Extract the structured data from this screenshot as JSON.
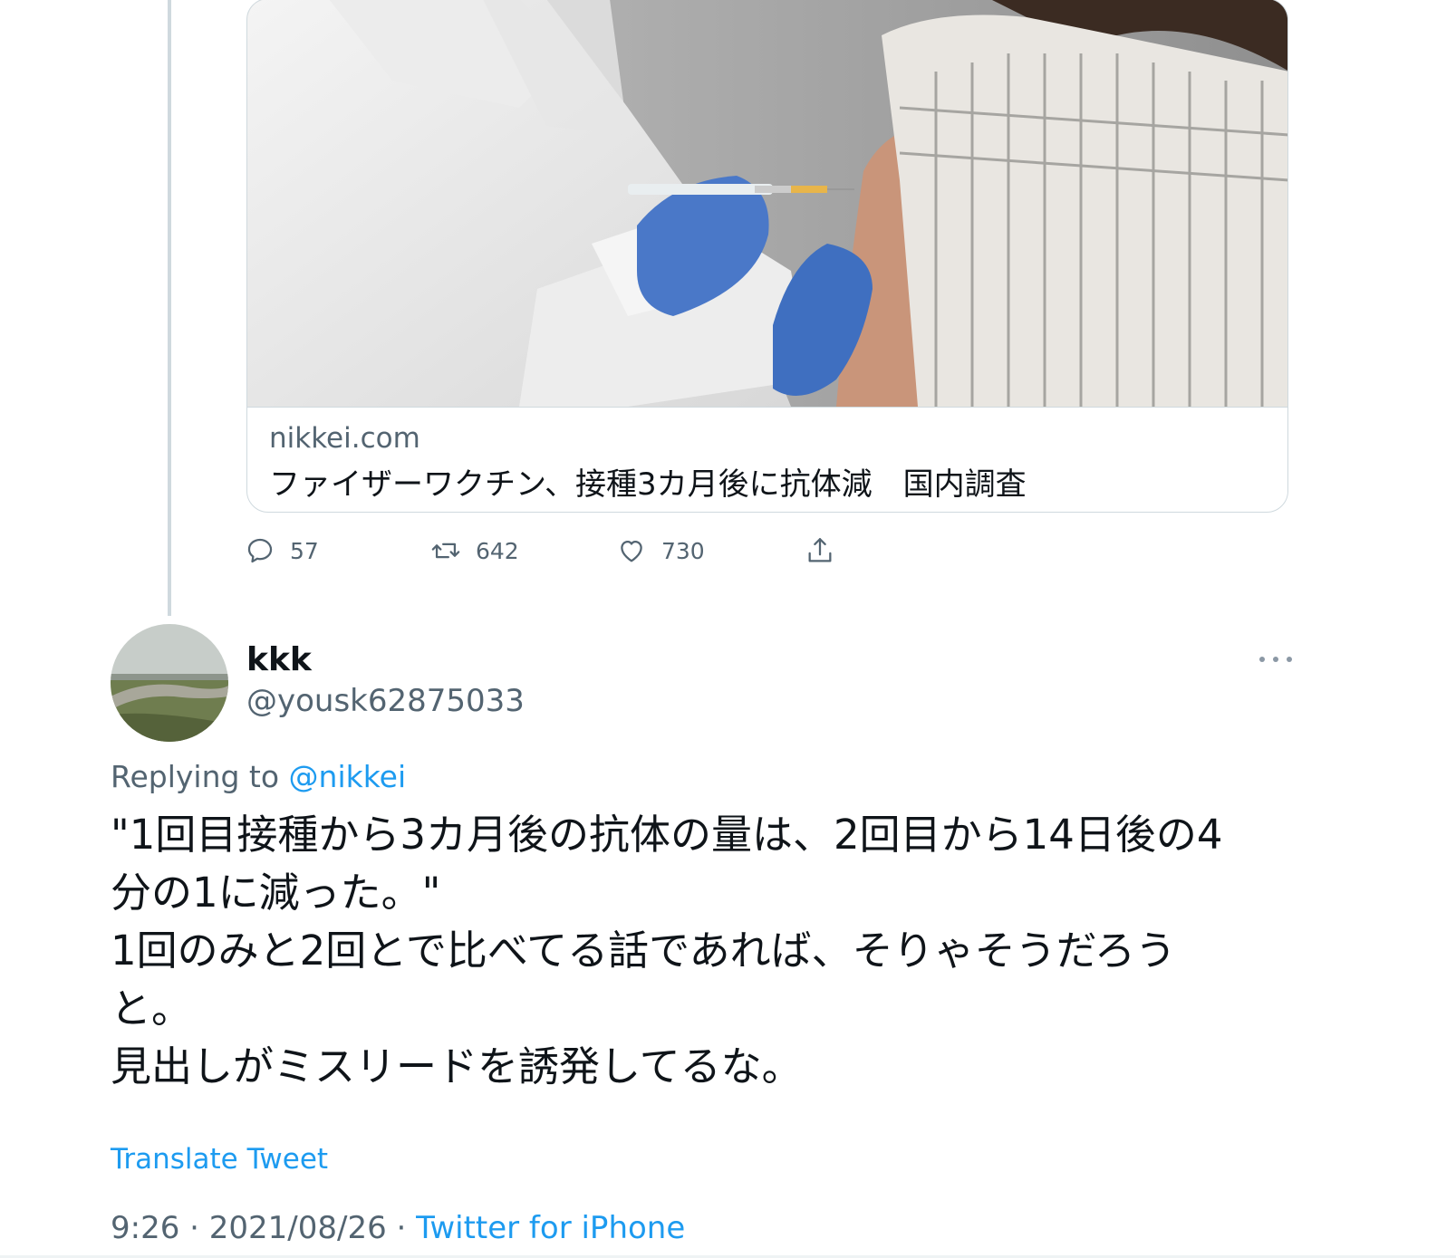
{
  "link_card": {
    "domain": "nikkei.com",
    "title": "ファイザーワクチン、接種3カ月後に抗体減　国内調査"
  },
  "actions": {
    "reply_count": "57",
    "retweet_count": "642",
    "like_count": "730"
  },
  "reply_tweet": {
    "display_name": "kkk",
    "handle": "@yousk62875033",
    "replying_prefix": "Replying to ",
    "replying_mention": "@nikkei",
    "text_lines": [
      "\"1回目接種から3カ月後の抗体の量は、2回目から14日後の4",
      "分の1に減った。\"",
      "1回のみと2回とで比べてる話であれば、そりゃそうだろう",
      "と。",
      "見出しがミスリードを誘発してるな。"
    ],
    "translate_label": "Translate Tweet",
    "time": "9:26 · 2021/08/26 · ",
    "source": "Twitter for iPhone"
  },
  "colors": {
    "accent": "#1d9bf0",
    "secondary_text": "#536471",
    "border": "#cfd9de"
  }
}
